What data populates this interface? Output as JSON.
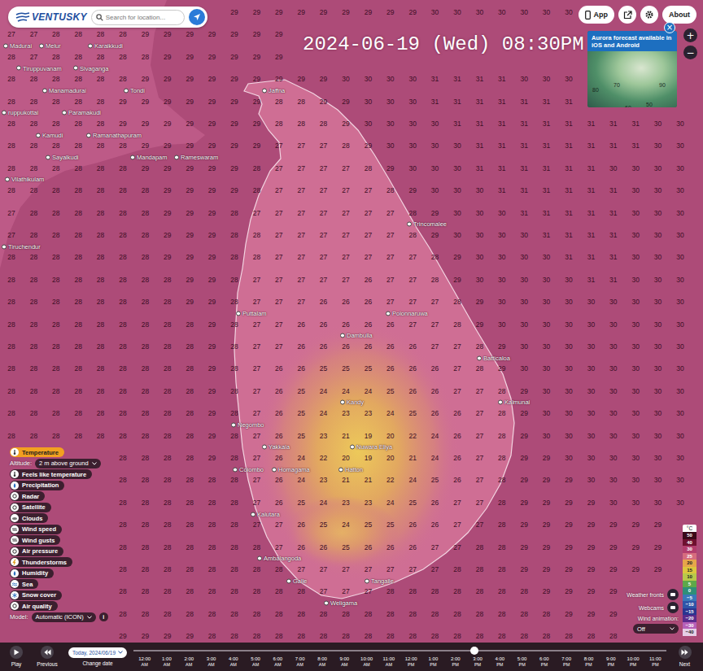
{
  "header": {
    "logo": "VENTUSKY",
    "search_placeholder": "Search for location...",
    "buttons": [
      "App",
      "About"
    ]
  },
  "title": "2024-06-19 (Wed) 08:30PM",
  "promo": {
    "text": "Aurora forecast available in iOS and Android",
    "close": "×",
    "map_labels": [
      "80",
      "70",
      "90",
      "50",
      "60",
      "50"
    ]
  },
  "zoom": [
    "+",
    "−"
  ],
  "map": {
    "grid": [
      [
        "",
        "",
        "",
        "",
        "",
        "",
        "",
        "",
        "",
        "",
        "29",
        "29",
        "29",
        "29",
        "29",
        "29",
        "29",
        "29",
        "29",
        "30",
        "30",
        "30",
        "30",
        "30",
        "30",
        "30",
        "",
        "",
        "",
        "",
        ""
      ],
      [
        "27",
        "27",
        "28",
        "28",
        "28",
        "28",
        "29",
        "29",
        "29",
        "29",
        "29",
        "29",
        "29",
        "",
        "",
        "",
        "",
        "",
        "",
        "",
        "",
        "",
        "",
        "",
        "",
        "",
        "",
        "",
        "",
        "",
        ""
      ],
      [
        "28",
        "27",
        "28",
        "28",
        "28",
        "28",
        "28",
        "29",
        "29",
        "29",
        "29",
        "29",
        "29",
        "",
        "",
        "",
        "",
        "",
        "",
        "",
        "",
        "",
        "",
        "",
        "",
        "",
        "",
        "",
        "",
        "",
        ""
      ],
      [
        "28",
        "28",
        "28",
        "28",
        "28",
        "28",
        "29",
        "29",
        "29",
        "29",
        "29",
        "29",
        "29",
        "29",
        "29",
        "30",
        "30",
        "30",
        "30",
        "31",
        "31",
        "31",
        "31",
        "30",
        "30",
        "30",
        "",
        "",
        "",
        "",
        ""
      ],
      [
        "28",
        "28",
        "28",
        "28",
        "28",
        "29",
        "29",
        "29",
        "29",
        "29",
        "29",
        "29",
        "28",
        "28",
        "29",
        "29",
        "30",
        "30",
        "30",
        "31",
        "31",
        "31",
        "31",
        "31",
        "31",
        "31",
        "",
        "",
        "",
        "",
        ""
      ],
      [
        "28",
        "28",
        "28",
        "28",
        "28",
        "29",
        "29",
        "29",
        "29",
        "29",
        "29",
        "29",
        "28",
        "28",
        "28",
        "29",
        "30",
        "30",
        "30",
        "30",
        "31",
        "31",
        "31",
        "31",
        "31",
        "31",
        "31",
        "31",
        "31",
        "30",
        "30"
      ],
      [
        "28",
        "28",
        "28",
        "28",
        "28",
        "28",
        "29",
        "29",
        "29",
        "29",
        "29",
        "29",
        "27",
        "27",
        "27",
        "28",
        "29",
        "30",
        "30",
        "30",
        "30",
        "31",
        "31",
        "31",
        "31",
        "31",
        "31",
        "31",
        "31",
        "30",
        "30"
      ],
      [
        "28",
        "28",
        "28",
        "28",
        "28",
        "28",
        "29",
        "29",
        "29",
        "29",
        "29",
        "28",
        "27",
        "27",
        "27",
        "27",
        "28",
        "29",
        "30",
        "30",
        "30",
        "31",
        "31",
        "31",
        "31",
        "31",
        "31",
        "30",
        "30",
        "30",
        "30"
      ],
      [
        "28",
        "28",
        "28",
        "28",
        "28",
        "28",
        "28",
        "29",
        "29",
        "29",
        "29",
        "28",
        "27",
        "27",
        "27",
        "27",
        "27",
        "28",
        "29",
        "30",
        "30",
        "30",
        "31",
        "31",
        "31",
        "31",
        "31",
        "31",
        "30",
        "30",
        "30"
      ],
      [
        "27",
        "28",
        "28",
        "28",
        "28",
        "28",
        "28",
        "29",
        "29",
        "29",
        "28",
        "27",
        "27",
        "27",
        "27",
        "27",
        "27",
        "27",
        "28",
        "29",
        "30",
        "30",
        "30",
        "31",
        "31",
        "31",
        "31",
        "31",
        "30",
        "30",
        "30"
      ],
      [
        "27",
        "28",
        "28",
        "28",
        "28",
        "28",
        "28",
        "29",
        "29",
        "29",
        "28",
        "28",
        "27",
        "27",
        "27",
        "27",
        "27",
        "27",
        "28",
        "29",
        "30",
        "30",
        "30",
        "30",
        "31",
        "31",
        "31",
        "31",
        "30",
        "30",
        "30"
      ],
      [
        "28",
        "28",
        "28",
        "28",
        "28",
        "28",
        "28",
        "29",
        "29",
        "29",
        "28",
        "28",
        "27",
        "27",
        "27",
        "27",
        "27",
        "27",
        "27",
        "28",
        "29",
        "30",
        "30",
        "30",
        "30",
        "31",
        "31",
        "31",
        "30",
        "30",
        "30"
      ],
      [
        "28",
        "28",
        "28",
        "28",
        "28",
        "28",
        "28",
        "28",
        "29",
        "29",
        "28",
        "27",
        "27",
        "27",
        "27",
        "27",
        "26",
        "27",
        "27",
        "28",
        "29",
        "30",
        "30",
        "30",
        "30",
        "30",
        "31",
        "31",
        "30",
        "30",
        "30"
      ],
      [
        "28",
        "28",
        "28",
        "28",
        "28",
        "28",
        "28",
        "28",
        "29",
        "29",
        "28",
        "27",
        "27",
        "27",
        "26",
        "26",
        "26",
        "27",
        "27",
        "27",
        "28",
        "29",
        "30",
        "30",
        "30",
        "30",
        "30",
        "30",
        "30",
        "30",
        "30"
      ],
      [
        "28",
        "28",
        "28",
        "28",
        "28",
        "28",
        "28",
        "28",
        "28",
        "29",
        "28",
        "27",
        "27",
        "26",
        "26",
        "26",
        "26",
        "26",
        "27",
        "27",
        "28",
        "29",
        "30",
        "30",
        "30",
        "30",
        "30",
        "30",
        "30",
        "30",
        "30"
      ],
      [
        "28",
        "28",
        "28",
        "28",
        "28",
        "28",
        "28",
        "28",
        "28",
        "29",
        "28",
        "27",
        "27",
        "26",
        "26",
        "26",
        "26",
        "26",
        "26",
        "27",
        "27",
        "28",
        "29",
        "30",
        "30",
        "30",
        "30",
        "30",
        "30",
        "30",
        "30"
      ],
      [
        "28",
        "28",
        "28",
        "28",
        "28",
        "28",
        "28",
        "28",
        "28",
        "29",
        "28",
        "27",
        "26",
        "26",
        "25",
        "25",
        "25",
        "26",
        "26",
        "26",
        "27",
        "28",
        "29",
        "30",
        "30",
        "30",
        "30",
        "30",
        "30",
        "30",
        "30"
      ],
      [
        "28",
        "28",
        "28",
        "28",
        "28",
        "28",
        "28",
        "28",
        "28",
        "29",
        "28",
        "27",
        "26",
        "25",
        "24",
        "24",
        "24",
        "25",
        "26",
        "26",
        "27",
        "27",
        "28",
        "29",
        "30",
        "30",
        "30",
        "30",
        "30",
        "30",
        "30"
      ],
      [
        "28",
        "28",
        "28",
        "28",
        "28",
        "28",
        "28",
        "28",
        "28",
        "29",
        "28",
        "27",
        "26",
        "25",
        "24",
        "23",
        "23",
        "24",
        "25",
        "26",
        "26",
        "27",
        "28",
        "29",
        "30",
        "30",
        "30",
        "30",
        "30",
        "30",
        "30"
      ],
      [
        "28",
        "28",
        "28",
        "28",
        "28",
        "28",
        "28",
        "28",
        "28",
        "29",
        "28",
        "27",
        "26",
        "25",
        "23",
        "21",
        "19",
        "20",
        "22",
        "24",
        "26",
        "27",
        "28",
        "29",
        "30",
        "30",
        "30",
        "30",
        "30",
        "30",
        "30"
      ],
      [
        "",
        "",
        "",
        "",
        "",
        "28",
        "28",
        "28",
        "28",
        "29",
        "28",
        "27",
        "26",
        "24",
        "22",
        "20",
        "19",
        "20",
        "21",
        "24",
        "26",
        "27",
        "28",
        "29",
        "29",
        "30",
        "30",
        "30",
        "30",
        "30",
        "30"
      ],
      [
        "",
        "",
        "",
        "",
        "",
        "28",
        "28",
        "28",
        "28",
        "28",
        "28",
        "27",
        "26",
        "24",
        "23",
        "21",
        "21",
        "22",
        "24",
        "25",
        "26",
        "27",
        "28",
        "29",
        "29",
        "29",
        "30",
        "30",
        "30",
        "30",
        "30"
      ],
      [
        "",
        "",
        "",
        "",
        "",
        "28",
        "28",
        "28",
        "28",
        "28",
        "28",
        "27",
        "26",
        "25",
        "24",
        "23",
        "23",
        "24",
        "25",
        "26",
        "27",
        "27",
        "28",
        "29",
        "29",
        "29",
        "29",
        "30",
        "30",
        "30",
        "30"
      ],
      [
        "",
        "",
        "",
        "",
        "",
        "28",
        "28",
        "28",
        "28",
        "28",
        "28",
        "27",
        "27",
        "26",
        "25",
        "24",
        "25",
        "25",
        "26",
        "26",
        "27",
        "27",
        "28",
        "29",
        "29",
        "29",
        "29",
        "29",
        "29",
        "29",
        ""
      ],
      [
        "",
        "",
        "",
        "",
        "",
        "28",
        "28",
        "28",
        "28",
        "28",
        "28",
        "28",
        "27",
        "26",
        "26",
        "25",
        "26",
        "26",
        "26",
        "27",
        "27",
        "28",
        "28",
        "29",
        "29",
        "29",
        "29",
        "29",
        "29",
        "29",
        ""
      ],
      [
        "",
        "",
        "",
        "",
        "",
        "28",
        "28",
        "28",
        "28",
        "28",
        "28",
        "28",
        "28",
        "27",
        "27",
        "27",
        "27",
        "27",
        "27",
        "27",
        "28",
        "28",
        "28",
        "29",
        "29",
        "29",
        "29",
        "29",
        "29",
        "29",
        ""
      ],
      [
        "",
        "",
        "",
        "",
        "",
        "28",
        "28",
        "28",
        "28",
        "28",
        "28",
        "28",
        "28",
        "28",
        "27",
        "27",
        "27",
        "28",
        "28",
        "28",
        "28",
        "28",
        "28",
        "28",
        "29",
        "29",
        "29",
        "29",
        "",
        "",
        ""
      ],
      [
        "",
        "",
        "",
        "",
        "",
        "28",
        "28",
        "28",
        "28",
        "28",
        "28",
        "28",
        "28",
        "28",
        "28",
        "28",
        "28",
        "28",
        "28",
        "28",
        "28",
        "28",
        "28",
        "28",
        "28",
        "29",
        "29",
        "29",
        "",
        "",
        ""
      ],
      [
        "",
        "",
        "",
        "",
        "",
        "29",
        "29",
        "29",
        "29",
        "28",
        "28",
        "28",
        "28",
        "28",
        "28",
        "28",
        "28",
        "28",
        "28",
        "28",
        "28",
        "28",
        "28",
        "28",
        "28",
        "28",
        "28",
        "28",
        "",
        "",
        ""
      ]
    ],
    "cities": [
      "Madurai",
      "Melur",
      "Karaikkudi",
      "Tiruppuvanam",
      "Sivaganga",
      "Manamadurai",
      "Tondi",
      "ruppukottai",
      "Paramakudi",
      "Kamudi",
      "Ramanathapuram",
      "Sayalkudi",
      "Mandapam",
      "Rameswaram",
      "Vilathikulam",
      "Tiruchendur",
      "Jaffna",
      "Trincomalee",
      "Polonnaruwa",
      "Puttalam",
      "Dambulla",
      "Batticaloa",
      "Kandy",
      "Kalmunai",
      "Negombo",
      "Yakkala",
      "Nuwara Eliya",
      "Colombo",
      "Homagama",
      "Hatton",
      "Kalutara",
      "Ambalangoda",
      "Galle",
      "Tangalle",
      "Weligama"
    ]
  },
  "layers": {
    "items": [
      {
        "label": "Temperature",
        "selected": true
      },
      {
        "label": "Feels like temperature",
        "selected": false
      },
      {
        "label": "Precipitation",
        "selected": false
      },
      {
        "label": "Radar",
        "selected": false
      },
      {
        "label": "Satellite",
        "selected": false
      },
      {
        "label": "Clouds",
        "selected": false
      },
      {
        "label": "Wind speed",
        "selected": false
      },
      {
        "label": "Wind gusts",
        "selected": false
      },
      {
        "label": "Air pressure",
        "selected": false
      },
      {
        "label": "Thunderstorms",
        "selected": false
      },
      {
        "label": "Humidity",
        "selected": false
      },
      {
        "label": "Sea",
        "selected": false
      },
      {
        "label": "Snow cover",
        "selected": false
      },
      {
        "label": "Air quality",
        "selected": false
      }
    ],
    "altitude": {
      "label": "Altitude:",
      "value": "2 m above ground"
    },
    "model": {
      "label": "Model:",
      "value": "Automatic (ICON)",
      "info": "i"
    }
  },
  "legend": {
    "unit": "°C",
    "steps": [
      {
        "label": "50",
        "color": "#3a0a1a"
      },
      {
        "label": "40",
        "color": "#6e1030"
      },
      {
        "label": "30",
        "color": "#b33e6e"
      },
      {
        "label": "25",
        "color": "#d66c7e"
      },
      {
        "label": "20",
        "color": "#e6a64a"
      },
      {
        "label": "15",
        "color": "#dcc63e"
      },
      {
        "label": "10",
        "color": "#b8c94a"
      },
      {
        "label": "5",
        "color": "#5ea84a"
      },
      {
        "label": "0",
        "color": "#2f8f78"
      },
      {
        "label": "−5",
        "color": "#3a78b8"
      },
      {
        "label": "−10",
        "color": "#2f55a8"
      },
      {
        "label": "−15",
        "color": "#2a3590"
      },
      {
        "label": "−20",
        "color": "#5a2b8c"
      },
      {
        "label": "−30",
        "color": "#b65fb8"
      },
      {
        "label": "−40",
        "color": "#e6cfe6"
      }
    ]
  },
  "controls": {
    "toggles": [
      "Weather fronts",
      "Webcams"
    ],
    "wind_animation": {
      "label": "Wind animation:",
      "value": "Off"
    }
  },
  "timeline": {
    "play": "Play",
    "previous": "Previous",
    "date": "Today, 2024/06/19",
    "change_date": "Change date",
    "next": "Next",
    "level": 0.64,
    "hours": [
      {
        "time": "12:00",
        "period": "AM"
      },
      {
        "time": "1:00",
        "period": "AM"
      },
      {
        "time": "2:00",
        "period": "AM"
      },
      {
        "time": "3:00",
        "period": "AM"
      },
      {
        "time": "4:00",
        "period": "AM"
      },
      {
        "time": "5:00",
        "period": "AM"
      },
      {
        "time": "6:00",
        "period": "AM"
      },
      {
        "time": "7:00",
        "period": "AM"
      },
      {
        "time": "8:00",
        "period": "AM"
      },
      {
        "time": "9:00",
        "period": "AM"
      },
      {
        "time": "10:00",
        "period": "AM"
      },
      {
        "time": "11:00",
        "period": "AM"
      },
      {
        "time": "12:00",
        "period": "PM"
      },
      {
        "time": "1:00",
        "period": "PM"
      },
      {
        "time": "2:00",
        "period": "PM"
      },
      {
        "time": "3:00",
        "period": "PM"
      },
      {
        "time": "4:00",
        "period": "PM"
      },
      {
        "time": "5:00",
        "period": "PM"
      },
      {
        "time": "6:00",
        "period": "PM"
      },
      {
        "time": "7:00",
        "period": "PM"
      },
      {
        "time": "8:00",
        "period": "PM"
      },
      {
        "time": "9:00",
        "period": "PM"
      },
      {
        "time": "10:00",
        "period": "PM"
      },
      {
        "time": "11:00",
        "period": "PM"
      }
    ]
  }
}
